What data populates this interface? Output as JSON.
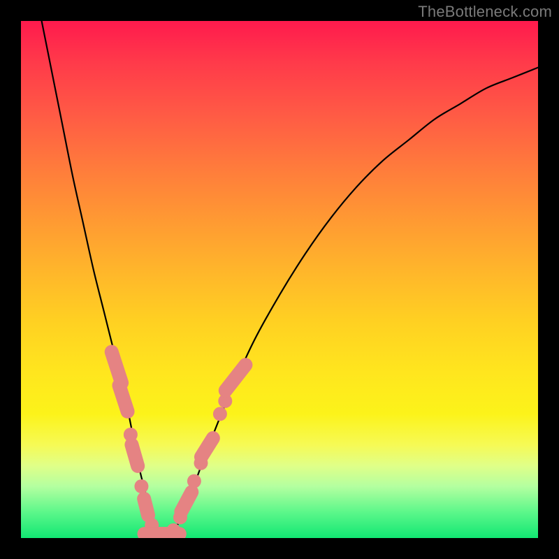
{
  "watermark": "TheBottleneck.com",
  "colors": {
    "frame": "#000000",
    "gradient_top": "#ff1a4d",
    "gradient_bottom": "#12e773",
    "curve": "#000000",
    "marker": "#e58383",
    "watermark": "#7a7a7a"
  },
  "chart_data": {
    "type": "line",
    "title": "",
    "xlabel": "",
    "ylabel": "",
    "xlim": [
      0,
      100
    ],
    "ylim": [
      0,
      100
    ],
    "curve": {
      "name": "bottleneck-curve",
      "x": [
        4,
        6,
        8,
        10,
        12,
        14,
        16,
        18,
        20,
        22,
        23,
        24,
        25,
        26,
        27,
        28,
        30,
        33,
        36,
        40,
        45,
        50,
        55,
        60,
        65,
        70,
        75,
        80,
        85,
        90,
        95,
        100
      ],
      "y": [
        100,
        90,
        80,
        70,
        61,
        52,
        44,
        36,
        28,
        18,
        13,
        9,
        5,
        2,
        0,
        0,
        2,
        9,
        17,
        27,
        38,
        47,
        55,
        62,
        68,
        73,
        77,
        81,
        84,
        87,
        89,
        91
      ]
    },
    "markers": {
      "name": "highlighted-points",
      "points": [
        {
          "x": 18.5,
          "y": 33,
          "type": "pill",
          "angle": 72,
          "len": 9
        },
        {
          "x": 19.8,
          "y": 27,
          "type": "pill",
          "angle": 72,
          "len": 8
        },
        {
          "x": 21.2,
          "y": 20,
          "type": "dot"
        },
        {
          "x": 22.0,
          "y": 16,
          "type": "pill",
          "angle": 74,
          "len": 7
        },
        {
          "x": 23.3,
          "y": 10,
          "type": "dot"
        },
        {
          "x": 24.2,
          "y": 6,
          "type": "pill",
          "angle": 76,
          "len": 6
        },
        {
          "x": 25.3,
          "y": 2.5,
          "type": "dot"
        },
        {
          "x": 26.5,
          "y": 0.8,
          "type": "pill",
          "angle": 0,
          "len": 8
        },
        {
          "x": 28.0,
          "y": 0.8,
          "type": "pill",
          "angle": 0,
          "len": 8
        },
        {
          "x": 29.5,
          "y": 1.5,
          "type": "dot"
        },
        {
          "x": 30.8,
          "y": 4,
          "type": "dot"
        },
        {
          "x": 32.0,
          "y": 7,
          "type": "pill",
          "angle": -62,
          "len": 7
        },
        {
          "x": 33.5,
          "y": 11,
          "type": "dot"
        },
        {
          "x": 34.8,
          "y": 14.5,
          "type": "dot"
        },
        {
          "x": 36.0,
          "y": 17.5,
          "type": "pill",
          "angle": -58,
          "len": 7
        },
        {
          "x": 38.5,
          "y": 24,
          "type": "dot"
        },
        {
          "x": 39.5,
          "y": 26.5,
          "type": "dot"
        },
        {
          "x": 41.5,
          "y": 31,
          "type": "pill",
          "angle": -52,
          "len": 9
        }
      ]
    }
  }
}
